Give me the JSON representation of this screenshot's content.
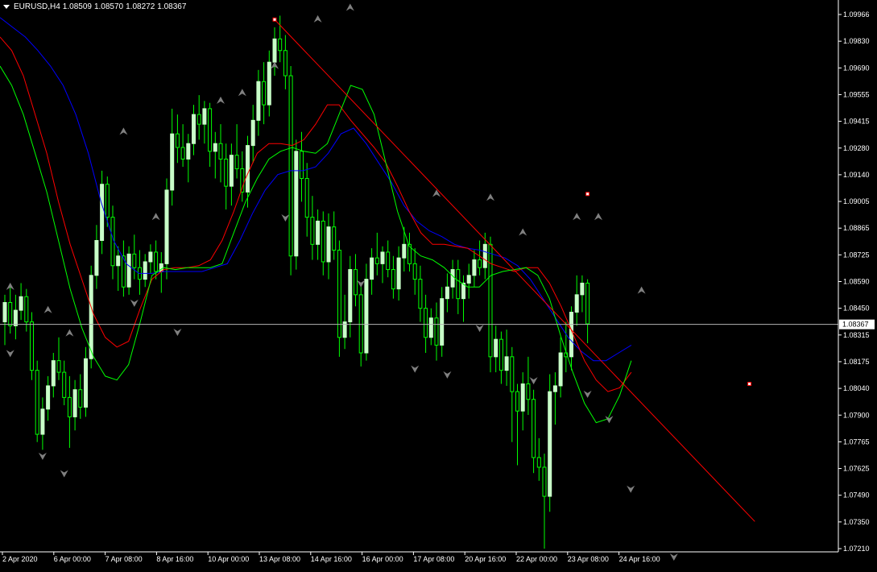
{
  "header": {
    "symbol": "EURUSD,H4",
    "open": "1.08509",
    "high": "1.08570",
    "low": "1.08272",
    "close": "1.08367"
  },
  "colors": {
    "background": "#000000",
    "bull_candle": "#c8ffc8",
    "wick": "#00ff00",
    "ma_fast": "#00ff00",
    "ma_mid": "#ff0000",
    "ma_slow": "#0000ff",
    "trendline": "#ff0000",
    "fractal": "#808080",
    "axis_text": "#ffffff"
  },
  "chart_data": {
    "type": "candlestick",
    "current_price": "1.08367",
    "y_ticks": [
      "1.09966",
      "1.09830",
      "1.09690",
      "1.09555",
      "1.09415",
      "1.09280",
      "1.09140",
      "1.09005",
      "1.08865",
      "1.08725",
      "1.08590",
      "1.08450",
      "1.08315",
      "1.08175",
      "1.08040",
      "1.07900",
      "1.07765",
      "1.07625",
      "1.07490",
      "1.07350",
      "1.07210"
    ],
    "ylim": [
      1.0721,
      1.09966
    ],
    "x_ticks": [
      "2 Apr 2020",
      "6 Apr 00:00",
      "7 Apr 08:00",
      "8 Apr 16:00",
      "10 Apr 00:00",
      "13 Apr 08:00",
      "14 Apr 16:00",
      "16 Apr 00:00",
      "17 Apr 08:00",
      "20 Apr 16:00",
      "22 Apr 00:00",
      "23 Apr 08:00",
      "24 Apr 16:00"
    ],
    "candles": [
      [
        1.0838,
        1.0852,
        1.0826,
        1.0848
      ],
      [
        1.0848,
        1.0856,
        1.0832,
        1.0836
      ],
      [
        1.0836,
        1.0852,
        1.0829,
        1.0844
      ],
      [
        1.0844,
        1.0858,
        1.0839,
        1.0851
      ],
      [
        1.0851,
        1.0855,
        1.0833,
        1.0838
      ],
      [
        1.0838,
        1.0843,
        1.0808,
        1.0813
      ],
      [
        1.0813,
        1.0818,
        1.0776,
        1.078
      ],
      [
        1.078,
        1.0799,
        1.0772,
        1.0793
      ],
      [
        1.0793,
        1.081,
        1.0787,
        1.0805
      ],
      [
        1.0805,
        1.0822,
        1.0799,
        1.0818
      ],
      [
        1.0818,
        1.083,
        1.0808,
        1.0812
      ],
      [
        1.0812,
        1.0818,
        1.0795,
        1.0799
      ],
      [
        1.0799,
        1.081,
        1.0773,
        1.0789
      ],
      [
        1.0789,
        1.0808,
        1.0782,
        1.0803
      ],
      [
        1.0803,
        1.0811,
        1.0788,
        1.0794
      ],
      [
        1.0794,
        1.0825,
        1.0789,
        1.0819
      ],
      [
        1.0819,
        1.0867,
        1.0814,
        1.0862
      ],
      [
        1.0862,
        1.0888,
        1.0855,
        1.088
      ],
      [
        1.088,
        1.0916,
        1.0873,
        1.0909
      ],
      [
        1.0909,
        1.0913,
        1.0887,
        1.0892
      ],
      [
        1.0892,
        1.0898,
        1.086,
        1.0867
      ],
      [
        1.0867,
        1.0877,
        1.0854,
        1.0872
      ],
      [
        1.0872,
        1.088,
        1.0851,
        1.0856
      ],
      [
        1.0856,
        1.0877,
        1.0852,
        1.0873
      ],
      [
        1.0873,
        1.0883,
        1.086,
        1.0866
      ],
      [
        1.0866,
        1.0875,
        1.0852,
        1.086
      ],
      [
        1.086,
        1.0873,
        1.0856,
        1.0869
      ],
      [
        1.0869,
        1.0878,
        1.0863,
        1.0874
      ],
      [
        1.0874,
        1.088,
        1.086,
        1.0864
      ],
      [
        1.0864,
        1.0874,
        1.0853,
        1.0868
      ],
      [
        1.0868,
        1.0912,
        1.086,
        1.0906
      ],
      [
        1.0906,
        1.0948,
        1.0898,
        1.0935
      ],
      [
        1.0935,
        1.0945,
        1.092,
        1.0928
      ],
      [
        1.0928,
        1.094,
        1.0918,
        1.0922
      ],
      [
        1.0922,
        1.0935,
        1.091,
        1.093
      ],
      [
        1.093,
        1.095,
        1.0924,
        1.0945
      ],
      [
        1.0945,
        1.0955,
        1.0932,
        1.094
      ],
      [
        1.094,
        1.0952,
        1.093,
        1.0948
      ],
      [
        1.0948,
        1.0951,
        1.0918,
        1.0926
      ],
      [
        1.0926,
        1.0936,
        1.0912,
        1.093
      ],
      [
        1.093,
        1.094,
        1.091,
        1.0922
      ],
      [
        1.0922,
        1.093,
        1.0896,
        1.0908
      ],
      [
        1.0908,
        1.093,
        1.0898,
        1.0924
      ],
      [
        1.0924,
        1.094,
        1.0912,
        1.0917
      ],
      [
        1.0917,
        1.0926,
        1.09,
        1.0905
      ],
      [
        1.0905,
        1.0934,
        1.0897,
        1.0929
      ],
      [
        1.0929,
        1.095,
        1.092,
        1.0942
      ],
      [
        1.0942,
        1.0968,
        1.0934,
        1.0962
      ],
      [
        1.0962,
        1.0972,
        1.094,
        1.095
      ],
      [
        1.095,
        1.0978,
        1.0944,
        1.0972
      ],
      [
        1.0972,
        1.099,
        1.0965,
        1.0984
      ],
      [
        1.0984,
        1.0996,
        1.0972,
        1.0978
      ],
      [
        1.0978,
        1.0986,
        1.0958,
        1.0965
      ],
      [
        1.0965,
        1.097,
        1.0862,
        1.0872
      ],
      [
        1.0872,
        1.0932,
        1.0865,
        1.0926
      ],
      [
        1.0926,
        1.0936,
        1.09,
        1.0912
      ],
      [
        1.0912,
        1.092,
        1.0882,
        1.0892
      ],
      [
        1.0892,
        1.0903,
        1.087,
        1.0878
      ],
      [
        1.0878,
        1.0896,
        1.087,
        1.089
      ],
      [
        1.089,
        1.0895,
        1.0862,
        1.0869
      ],
      [
        1.0869,
        1.0894,
        1.086,
        1.0887
      ],
      [
        1.0887,
        1.0895,
        1.087,
        1.0875
      ],
      [
        1.0875,
        1.088,
        1.082,
        1.083
      ],
      [
        1.083,
        1.0852,
        1.0824,
        1.0838
      ],
      [
        1.0838,
        1.0872,
        1.083,
        1.0865
      ],
      [
        1.0865,
        1.0873,
        1.0846,
        1.0852
      ],
      [
        1.0852,
        1.0858,
        1.0815,
        1.0822
      ],
      [
        1.0822,
        1.0868,
        1.0818,
        1.086
      ],
      [
        1.086,
        1.0876,
        1.0852,
        1.0871
      ],
      [
        1.0871,
        1.0884,
        1.0862,
        1.0868
      ],
      [
        1.0868,
        1.0877,
        1.0858,
        1.0874
      ],
      [
        1.0874,
        1.088,
        1.0861,
        1.0865
      ],
      [
        1.0865,
        1.0872,
        1.085,
        1.0855
      ],
      [
        1.0855,
        1.0877,
        1.0849,
        1.0871
      ],
      [
        1.0871,
        1.0887,
        1.0864,
        1.0878
      ],
      [
        1.0878,
        1.0884,
        1.0864,
        1.0868
      ],
      [
        1.0868,
        1.0876,
        1.0852,
        1.086
      ],
      [
        1.086,
        1.0867,
        1.0838,
        1.0845
      ],
      [
        1.0845,
        1.0852,
        1.0822,
        1.083
      ],
      [
        1.083,
        1.0845,
        1.0826,
        1.084
      ],
      [
        1.084,
        1.0848,
        1.0818,
        1.0826
      ],
      [
        1.0826,
        1.0856,
        1.082,
        1.085
      ],
      [
        1.085,
        1.0863,
        1.0843,
        1.0856
      ],
      [
        1.0856,
        1.087,
        1.085,
        1.0865
      ],
      [
        1.0865,
        1.087,
        1.0842,
        1.085
      ],
      [
        1.085,
        1.0862,
        1.0838,
        1.0858
      ],
      [
        1.0858,
        1.0868,
        1.085,
        1.0862
      ],
      [
        1.0862,
        1.0875,
        1.0856,
        1.087
      ],
      [
        1.087,
        1.088,
        1.0862,
        1.0866
      ],
      [
        1.0866,
        1.0884,
        1.086,
        1.0878
      ],
      [
        1.0878,
        1.0882,
        1.0812,
        1.082
      ],
      [
        1.082,
        1.0836,
        1.0812,
        1.0829
      ],
      [
        1.0829,
        1.0833,
        1.0806,
        1.0813
      ],
      [
        1.0813,
        1.0834,
        1.0805,
        1.082
      ],
      [
        1.082,
        1.0825,
        1.0776,
        1.0802
      ],
      [
        1.0802,
        1.0806,
        1.0764,
        1.0792
      ],
      [
        1.0792,
        1.0812,
        1.0782,
        1.0806
      ],
      [
        1.0806,
        1.082,
        1.079,
        1.0798
      ],
      [
        1.0798,
        1.0803,
        1.076,
        1.0768
      ],
      [
        1.0768,
        1.0778,
        1.0756,
        1.0763
      ],
      [
        1.0763,
        1.077,
        1.0721,
        1.0748
      ],
      [
        1.0748,
        1.0811,
        1.074,
        1.0802
      ],
      [
        1.0802,
        1.0812,
        1.0785,
        1.0805
      ],
      [
        1.0805,
        1.083,
        1.0799,
        1.0822
      ],
      [
        1.0822,
        1.0838,
        1.0812,
        1.082
      ],
      [
        1.082,
        1.0846,
        1.0813,
        1.0843
      ],
      [
        1.0843,
        1.0862,
        1.0836,
        1.0852
      ],
      [
        1.0852,
        1.0862,
        1.0843,
        1.0858
      ],
      [
        1.0858,
        1.086,
        1.0827,
        1.0837
      ]
    ],
    "ma_fast": [
      1.097,
      1.096,
      1.0945,
      1.0925,
      1.0905,
      1.088,
      1.0855,
      1.0835,
      1.082,
      1.081,
      1.0808,
      1.0816,
      1.0838,
      1.0862,
      1.0866,
      1.0865,
      1.0866,
      1.0866,
      1.0866,
      1.0868,
      1.0884,
      1.09,
      1.0912,
      1.0922,
      1.0926,
      1.0928,
      1.0926,
      1.0925,
      1.093,
      1.0945,
      1.096,
      1.0958,
      1.0945,
      1.092,
      1.0895,
      1.0877,
      1.0872,
      1.087,
      1.0866,
      1.086,
      1.0856,
      1.0856,
      1.0862,
      1.0864,
      1.0865,
      1.0866,
      1.0862,
      1.085,
      1.083,
      1.0812,
      1.0796,
      1.0786,
      1.0788,
      1.08,
      1.0818
    ],
    "ma_mid": [
      1.0985,
      1.0978,
      1.0965,
      1.0945,
      1.0925,
      1.09,
      1.0878,
      1.086,
      1.0842,
      1.083,
      1.0825,
      1.0828,
      1.0845,
      1.086,
      1.0865,
      1.0866,
      1.0866,
      1.0867,
      1.087,
      1.088,
      1.0895,
      1.0912,
      1.0925,
      1.093,
      1.093,
      1.0929,
      1.0932,
      1.094,
      1.095,
      1.095,
      1.0942,
      1.0935,
      1.0928,
      1.092,
      1.0908,
      1.0895,
      1.0884,
      1.0878,
      1.0878,
      1.0877,
      1.0876,
      1.0872,
      1.0868,
      1.0866,
      1.0864,
      1.0866,
      1.0866,
      1.0858,
      1.0846,
      1.0832,
      1.0818,
      1.0808,
      1.0802,
      1.0804,
      1.0812
    ],
    "ma_slow": [
      1.0995,
      1.099,
      1.0985,
      1.0978,
      1.097,
      1.096,
      1.0945,
      1.0925,
      1.09,
      1.088,
      1.0868,
      1.0863,
      1.0863,
      1.0864,
      1.0864,
      1.0864,
      1.0864,
      1.0866,
      1.0868,
      1.088,
      1.0894,
      1.0906,
      1.0914,
      1.0916,
      1.0916,
      1.0918,
      1.0925,
      1.0935,
      1.0938,
      1.093,
      1.092,
      1.091,
      1.0898,
      1.089,
      1.0885,
      1.0882,
      1.0878,
      1.0876,
      1.0875,
      1.0873,
      1.0871,
      1.0867,
      1.086,
      1.085,
      1.084,
      1.083,
      1.0823,
      1.0818,
      1.0818,
      1.0822,
      1.0826
    ],
    "trendline": {
      "from": [
        50,
        1.0994
      ],
      "to": [
        139,
        1.0735
      ]
    },
    "trendline_markers": [
      [
        50,
        1.0994
      ],
      [
        108,
        1.0904
      ],
      [
        138,
        1.0806
      ]
    ],
    "fractals_up": [
      [
        1,
        1.0852
      ],
      [
        8,
        1.084
      ],
      [
        12,
        1.0828
      ],
      [
        22,
        1.0932
      ],
      [
        28,
        1.0888
      ],
      [
        40,
        1.0948
      ],
      [
        44,
        1.0952
      ],
      [
        50,
        1.0966
      ],
      [
        58,
        1.099
      ],
      [
        64,
        1.0996
      ],
      [
        80,
        1.09
      ],
      [
        90,
        1.0898
      ],
      [
        96,
        1.088
      ],
      [
        106,
        1.0888
      ],
      [
        110,
        1.0888
      ],
      [
        118,
        1.085
      ]
    ],
    "fractals_down": [
      [
        1,
        1.0826
      ],
      [
        7,
        1.0773
      ],
      [
        11,
        1.0764
      ],
      [
        24,
        1.0852
      ],
      [
        32,
        1.0837
      ],
      [
        52,
        1.0896
      ],
      [
        66,
        1.0862
      ],
      [
        76,
        1.0818
      ],
      [
        82,
        1.0815
      ],
      [
        88,
        1.0839
      ],
      [
        98,
        1.0812
      ],
      [
        108,
        1.0805
      ],
      [
        112,
        1.0792
      ],
      [
        116,
        1.0756
      ],
      [
        124,
        1.0721
      ]
    ]
  }
}
